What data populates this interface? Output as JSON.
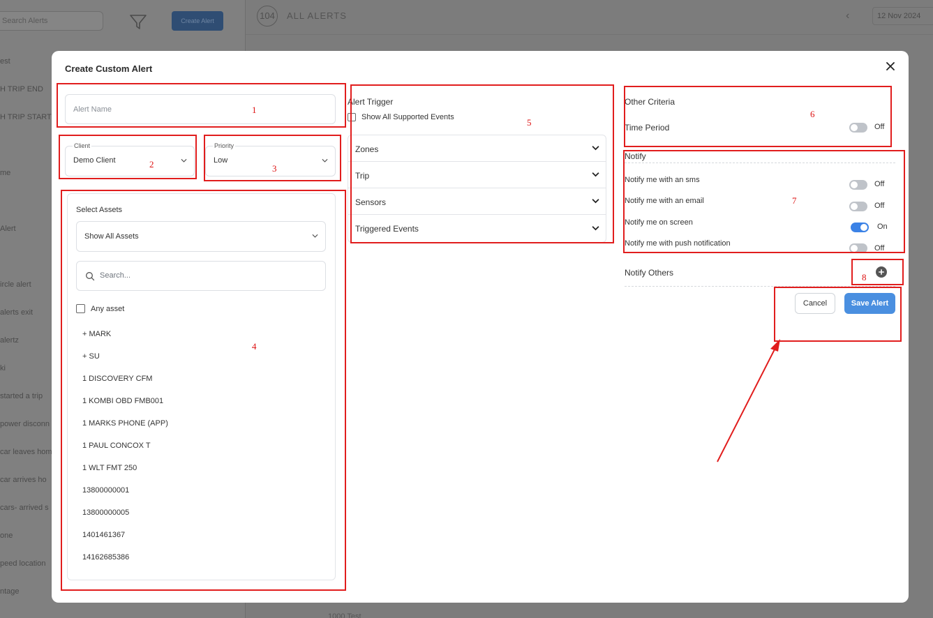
{
  "background": {
    "search_placeholder": "Search Alerts",
    "create_button": "Create Alert",
    "alerts_count": "104",
    "page_title": "ALL ALERTS",
    "date": "12 Nov 2024",
    "list_items": [
      "est",
      "H TRIP END",
      "H TRIP START",
      "me",
      "Alert",
      "ircle alert",
      "alerts exit",
      "alertz",
      "ki",
      "started a trip",
      "power disconn",
      "car leaves hom",
      "car arrives ho",
      "cars- arrived s",
      "one",
      "peed location",
      "ntage"
    ],
    "bottom_item": "1000 Test"
  },
  "modal": {
    "title": "Create Custom Alert",
    "alert_name_placeholder": "Alert Name",
    "client_label": "Client",
    "client_value": "Demo Client",
    "priority_label": "Priority",
    "priority_value": "Low",
    "select_assets_label": "Select Assets",
    "assets_filter_value": "Show All Assets",
    "assets_search_placeholder": "Search...",
    "any_asset_label": "Any asset",
    "assets": [
      "+ MARK",
      "+ SU",
      "1 DISCOVERY CFM",
      "1 KOMBI OBD FMB001",
      "1 MARKS PHONE (APP)",
      "1 PAUL CONCOX T",
      "1 WLT FMT 250",
      "13800000001",
      "13800000005",
      "1401461367",
      "14162685386"
    ],
    "alert_trigger_title": "Alert Trigger",
    "show_all_events_label": "Show All Supported Events",
    "trigger_sections": [
      "Zones",
      "Trip",
      "Sensors",
      "Triggered Events"
    ],
    "other_criteria_title": "Other Criteria",
    "time_period_label": "Time Period",
    "time_period_state": "Off",
    "notify_title": "Notify",
    "notify_rows": [
      {
        "label": "Notify me with an sms",
        "state": "Off"
      },
      {
        "label": "Notify me with an email",
        "state": "Off"
      },
      {
        "label": "Notify me on screen",
        "state": "On"
      },
      {
        "label": "Notify me with push notification",
        "state": "Off"
      }
    ],
    "notify_others_label": "Notify Others",
    "cancel_label": "Cancel",
    "save_label": "Save Alert"
  },
  "annotations": [
    "1",
    "2",
    "3",
    "4",
    "5",
    "6",
    "7",
    "8"
  ],
  "colors": {
    "annotation": "#e11d1d",
    "primary": "#4a8fe0",
    "toggle_on": "#3b82e6",
    "toggle_off": "#bfc3c9"
  }
}
